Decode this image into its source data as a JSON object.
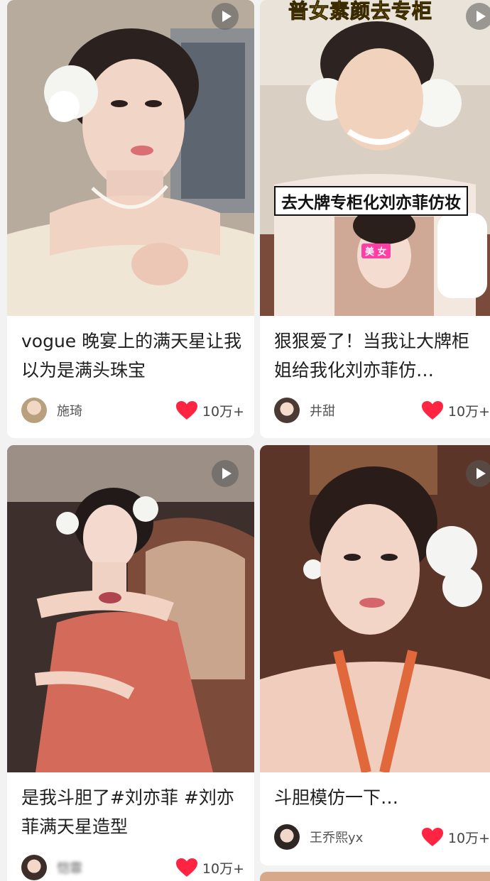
{
  "feed": {
    "cards": [
      {
        "title": "vogue 晚宴上的满天星让我以为是满头珠宝",
        "author": "施琦",
        "likes": "10万+",
        "is_video": true
      },
      {
        "title": "狠狠爱了！当我让大牌柜姐给我化刘亦菲仿…",
        "author": "井甜",
        "likes": "10万+",
        "is_video": true,
        "overlay_top": "普女素颜去专柜",
        "overlay_mid": "去大牌专柜化刘亦菲仿妆",
        "overlay_tag": "美 女"
      },
      {
        "title": "是我斗胆了#刘亦菲 #刘亦菲满天星造型",
        "author": "恺霏",
        "likes": "10万+",
        "is_video": true
      },
      {
        "title": "斗胆模仿一下…",
        "author": "王乔熙yx",
        "likes": "10万+",
        "is_video": true
      }
    ]
  },
  "colors": {
    "like_heart": "#ff2442",
    "background": "#f2f2f2",
    "banner_yellow": "#ffe600"
  }
}
